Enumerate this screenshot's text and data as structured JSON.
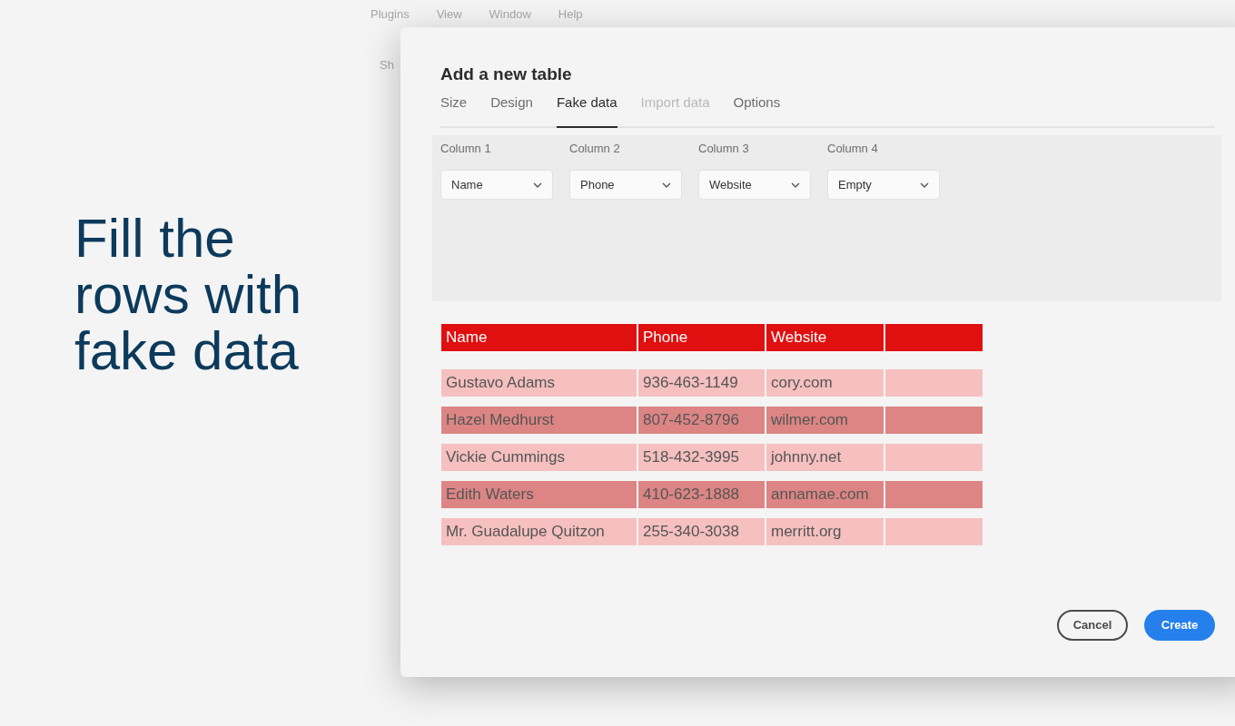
{
  "headline": "Fill the rows with fake data",
  "background_menu": [
    "Plugins",
    "View",
    "Window",
    "Help"
  ],
  "background_toolbar": {
    "label": "Sh"
  },
  "dialog": {
    "title": "Add a new table",
    "tabs": [
      {
        "label": "Size",
        "selected": false,
        "disabled": false
      },
      {
        "label": "Design",
        "selected": false,
        "disabled": false
      },
      {
        "label": "Fake data",
        "selected": true,
        "disabled": false
      },
      {
        "label": "Import data",
        "selected": false,
        "disabled": true
      },
      {
        "label": "Options",
        "selected": false,
        "disabled": false
      }
    ],
    "columns": [
      {
        "label": "Column 1",
        "value": "Name"
      },
      {
        "label": "Column 2",
        "value": "Phone"
      },
      {
        "label": "Column 3",
        "value": "Website"
      },
      {
        "label": "Column 4",
        "value": "Empty"
      }
    ],
    "preview": {
      "headers": [
        "Name",
        "Phone",
        "Website"
      ],
      "rows": [
        [
          "Gustavo Adams",
          "936-463-1149",
          "cory.com"
        ],
        [
          "Hazel Medhurst",
          "807-452-8796",
          "wilmer.com"
        ],
        [
          "Vickie Cummings",
          "518-432-3995",
          "johnny.net"
        ],
        [
          "Edith Waters",
          "410-623-1888",
          "annamae.com"
        ],
        [
          "Mr. Guadalupe Quitzon",
          "255-340-3038",
          "merritt.org"
        ]
      ]
    },
    "buttons": [
      {
        "label": "Cancel",
        "kind": "secondary"
      },
      {
        "label": "Create",
        "kind": "primary"
      }
    ]
  }
}
